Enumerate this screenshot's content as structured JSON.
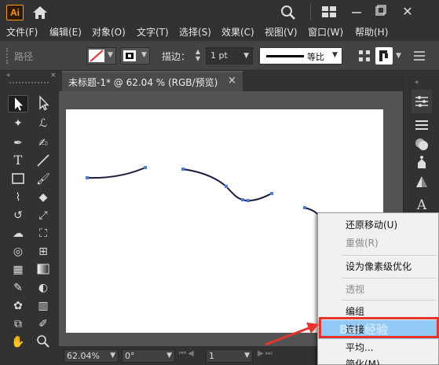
{
  "app": {
    "logo_text": "Ai"
  },
  "menu": [
    {
      "id": "file",
      "label": "文件(F)"
    },
    {
      "id": "edit",
      "label": "编辑(E)"
    },
    {
      "id": "object",
      "label": "对象(O)"
    },
    {
      "id": "type",
      "label": "文字(T)"
    },
    {
      "id": "select",
      "label": "选择(S)"
    },
    {
      "id": "effect",
      "label": "效果(C)"
    },
    {
      "id": "view",
      "label": "视图(V)"
    },
    {
      "id": "window",
      "label": "窗口(W)"
    },
    {
      "id": "help",
      "label": "帮助(H)"
    }
  ],
  "control_bar": {
    "selection_type": "路径",
    "stroke_label": "描边：",
    "stroke_weight": "1 pt",
    "profile_label": "等比",
    "colors": {
      "fill_none_slash": "#e8332a"
    }
  },
  "document": {
    "tab_title": "未标题-1* @ 62.04 % (RGB/预览)",
    "close_symbol": "×"
  },
  "status_bar": {
    "zoom": "62.04%",
    "rotation": "0°",
    "artboard_number": "1"
  },
  "context_menu": {
    "items": [
      {
        "label": "还原移动(U)",
        "enabled": true
      },
      {
        "label": "重做(R)",
        "enabled": false
      },
      {
        "label": "设为像素级优化",
        "enabled": true
      },
      {
        "label": "透视",
        "enabled": false
      },
      {
        "label": "编组",
        "enabled": true
      },
      {
        "label": "连接",
        "enabled": true,
        "highlighted": true
      },
      {
        "label": "平均...",
        "enabled": true
      },
      {
        "label": "简化(M)",
        "enabled": true
      }
    ],
    "highlight_color": "#91c9f7",
    "annotation_color": "#e8332a"
  },
  "watermark": {
    "text": "Bai 经验"
  },
  "icons": {
    "title_bar": [
      "home-icon",
      "search-icon",
      "workspace-switcher-icon",
      "minimize-icon",
      "maximize-icon",
      "close-icon"
    ],
    "tools": [
      "selection-tool",
      "direct-selection-tool",
      "magic-wand-tool",
      "lasso-tool",
      "pen-tool",
      "curvature-tool",
      "type-tool",
      "line-tool",
      "rectangle-tool",
      "paintbrush-tool",
      "shaper-tool",
      "eraser-tool",
      "rotate-tool",
      "scale-tool",
      "warp-tool",
      "free-transform-tool",
      "shape-builder-tool",
      "perspective-grid-tool",
      "mesh-tool",
      "gradient-tool",
      "eyedropper-tool",
      "blend-tool",
      "symbol-sprayer-tool",
      "column-graph-tool",
      "artboard-tool",
      "slice-tool",
      "hand-tool",
      "zoom-tool"
    ],
    "right_panel": [
      "properties-icon",
      "layers-icon",
      "color-icon",
      "libraries-icon",
      "transparency-icon",
      "character-icon"
    ]
  }
}
